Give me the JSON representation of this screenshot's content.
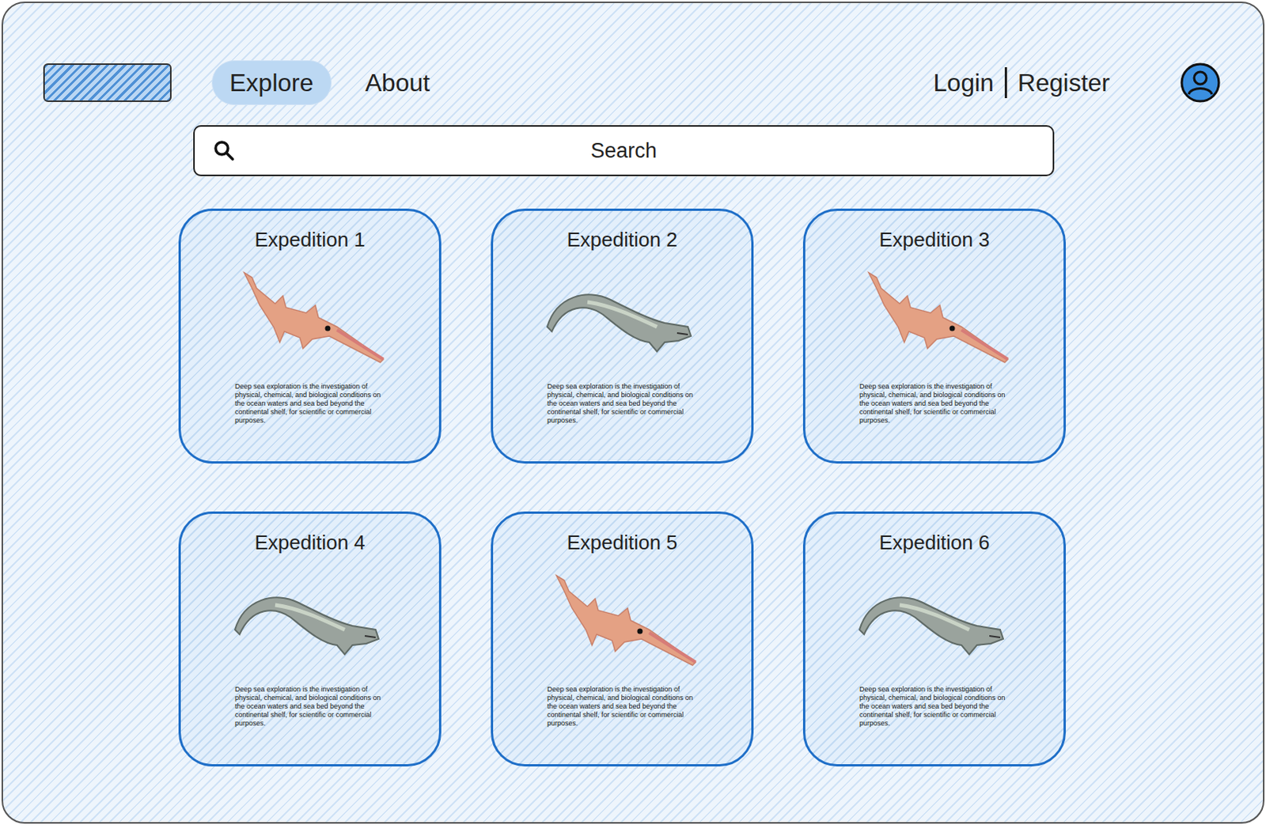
{
  "nav": {
    "tabs": [
      {
        "label": "Explore",
        "selected": true
      },
      {
        "label": "About",
        "selected": false
      }
    ],
    "auth": [
      "Login",
      "Register"
    ]
  },
  "search": {
    "placeholder": "Search"
  },
  "expeditions": [
    {
      "title": "Expedition 1",
      "kind": "sawshark",
      "description": "Deep sea exploration is the investigation of physical, chemical, and biological conditions on the ocean waters and sea bed beyond the continental shelf, for scientific or commercial purposes."
    },
    {
      "title": "Expedition 2",
      "kind": "frilled",
      "description": "Deep sea exploration is the investigation of physical, chemical, and biological conditions on the ocean waters and sea bed beyond the continental shelf, for scientific or commercial purposes."
    },
    {
      "title": "Expedition 3",
      "kind": "sawshark",
      "description": "Deep sea exploration is the investigation of physical, chemical, and biological conditions on the ocean waters and sea bed beyond the continental shelf, for scientific or commercial purposes."
    },
    {
      "title": "Expedition 4",
      "kind": "frilled",
      "description": "Deep sea exploration is the investigation of physical, chemical, and biological conditions on the ocean waters and sea bed beyond the continental shelf, for scientific or commercial purposes."
    },
    {
      "title": "Expedition 5",
      "kind": "sawshark",
      "description": "Deep sea exploration is the investigation of physical, chemical, and biological conditions on the ocean waters and sea bed beyond the continental shelf, for scientific or commercial purposes."
    },
    {
      "title": "Expedition 6",
      "kind": "frilled",
      "description": "Deep sea exploration is the investigation of physical, chemical, and biological conditions on the ocean waters and sea bed beyond the continental shelf, for scientific or commercial purposes."
    }
  ]
}
